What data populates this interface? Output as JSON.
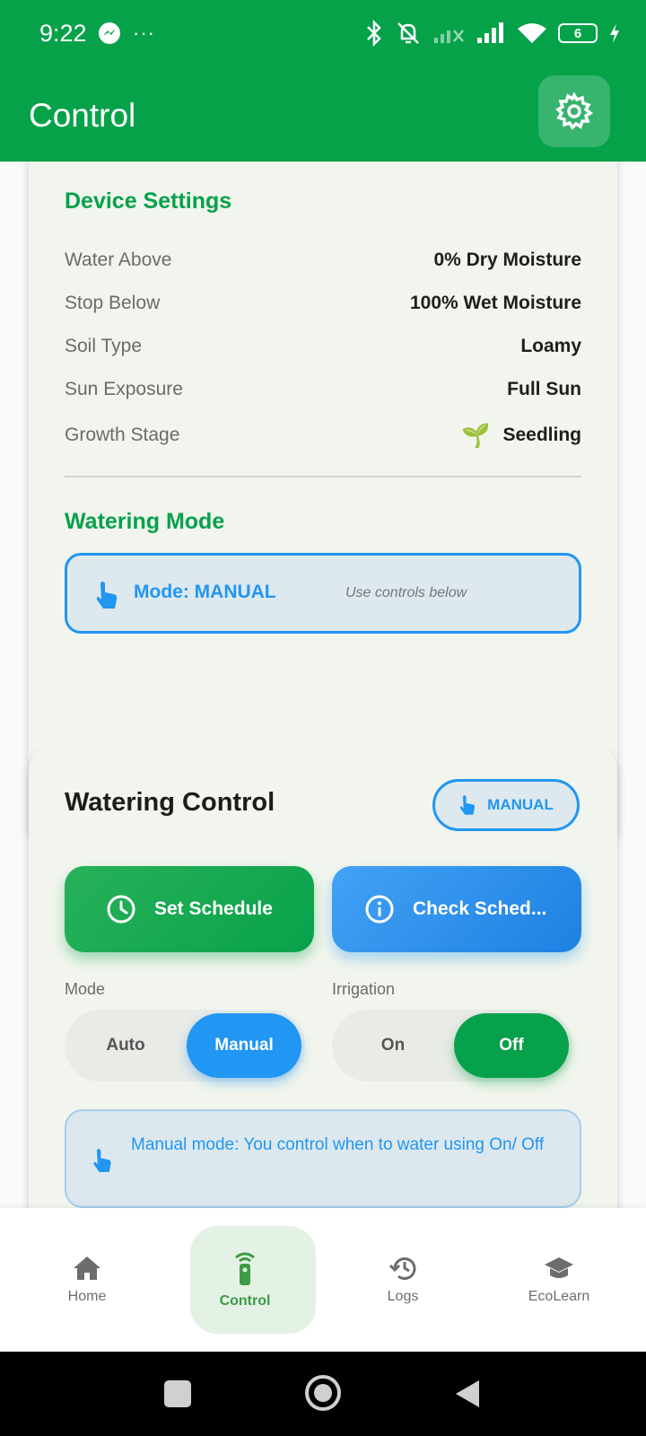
{
  "status_bar": {
    "time": "9:22",
    "dots": "···",
    "battery": "6"
  },
  "app_bar": {
    "title": "Control"
  },
  "device_settings": {
    "title": "Device Settings",
    "rows": [
      {
        "label": "Water Above",
        "value": "0% Dry Moisture"
      },
      {
        "label": "Stop Below",
        "value": "100% Wet Moisture"
      },
      {
        "label": "Soil Type",
        "value": "Loamy"
      },
      {
        "label": "Sun Exposure",
        "value": "Full Sun"
      },
      {
        "label": "Growth Stage",
        "value": "Seedling",
        "emoji": "🌱"
      }
    ]
  },
  "watering_mode": {
    "title": "Watering Mode",
    "mode_text": "Mode: MANUAL",
    "hint": "Use controls below"
  },
  "watering_control": {
    "title": "Watering Control",
    "chip": "MANUAL",
    "set_schedule": "Set Schedule",
    "check_schedule": "Check Sched...",
    "mode_label": "Mode",
    "mode_options": [
      "Auto",
      "Manual"
    ],
    "irrigation_label": "Irrigation",
    "irrigation_options": [
      "On",
      "Off"
    ],
    "info": "Manual mode: You control when to water using On/ Off"
  },
  "bottom_nav": {
    "items": [
      {
        "label": "Home"
      },
      {
        "label": "Control"
      },
      {
        "label": "Logs"
      },
      {
        "label": "EcoLearn"
      }
    ],
    "active": "Control"
  },
  "colors": {
    "primary_green": "#07a14b",
    "accent_blue": "#2196f3"
  }
}
